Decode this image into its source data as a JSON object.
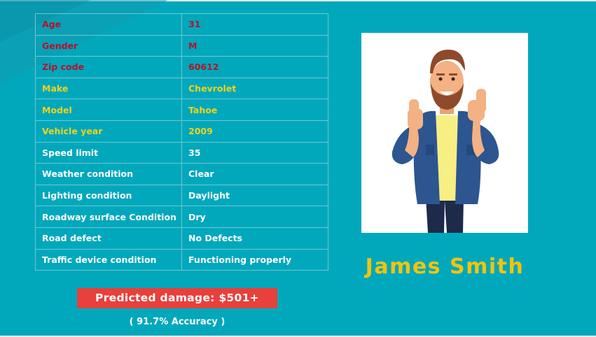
{
  "fields": [
    {
      "key": "Age",
      "value": "31",
      "group": "personal"
    },
    {
      "key": "Gender",
      "value": "M",
      "group": "personal"
    },
    {
      "key": "Zip code",
      "value": "60612",
      "group": "personal"
    },
    {
      "key": "Make",
      "value": "Chevrolet",
      "group": "vehicle"
    },
    {
      "key": "Model",
      "value": "Tahoe",
      "group": "vehicle"
    },
    {
      "key": "Vehicle year",
      "value": "2009",
      "group": "vehicle"
    },
    {
      "key": "Speed limit",
      "value": "35",
      "group": "conditions"
    },
    {
      "key": "Weather condition",
      "value": "Clear",
      "group": "conditions"
    },
    {
      "key": "Lighting condition",
      "value": "Daylight",
      "group": "conditions"
    },
    {
      "key": "Roadway surface Condition",
      "value": "Dry",
      "group": "conditions"
    },
    {
      "key": "Road defect",
      "value": "No Defects",
      "group": "conditions"
    },
    {
      "key": "Traffic device condition",
      "value": "Functioning properly",
      "group": "conditions"
    }
  ],
  "prediction": {
    "damage_label": "Predicted damage: $501+",
    "accuracy_label": "( 91.7% Accuracy )"
  },
  "person": {
    "name": "James Smith",
    "avatar_icon": "cartoon-man-thumbs-up-avatar"
  },
  "colors": {
    "background": "#01a8bc",
    "personal_text": "#b5122a",
    "vehicle_text": "#f2d21a",
    "condition_text": "#ffffff",
    "damage_badge": "#e8403b",
    "name_text": "#f2c40e"
  }
}
